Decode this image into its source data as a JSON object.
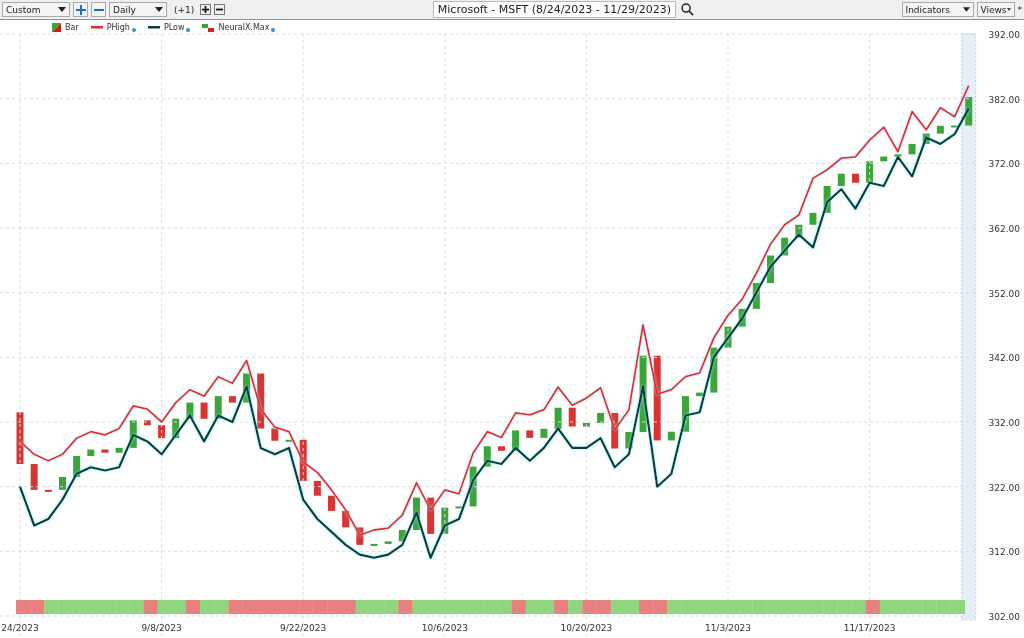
{
  "toolbar": {
    "layout_select": "Custom",
    "interval_select": "Daily",
    "offset": "(+1)",
    "symbol": "Microsoft - MSFT (8/24/2023 - 11/29/2023)",
    "indicators_menu": "Indicators",
    "views_menu": "Views",
    "modified_mark": "*"
  },
  "chart_data": {
    "type": "line",
    "legend": "top-left",
    "grid": true,
    "ylim": [
      302,
      392
    ],
    "categories": [
      "24/2023",
      null,
      null,
      null,
      null,
      null,
      null,
      null,
      null,
      null,
      "9/8/2023",
      null,
      null,
      null,
      null,
      null,
      null,
      null,
      null,
      null,
      "9/22/2023",
      null,
      null,
      null,
      null,
      null,
      null,
      null,
      null,
      null,
      "10/6/2023",
      null,
      null,
      null,
      null,
      null,
      null,
      null,
      null,
      null,
      "10/20/2023",
      null,
      null,
      null,
      null,
      null,
      null,
      null,
      null,
      null,
      "11/3/2023",
      null,
      null,
      null,
      null,
      null,
      null,
      null,
      null,
      null,
      "11/17/2023",
      null,
      null,
      null,
      null,
      null,
      null,
      null
    ],
    "yticks": [
      {
        "value": 392,
        "label": "392.00"
      },
      {
        "value": 382,
        "label": "382.00"
      },
      {
        "value": 372,
        "label": "372.00"
      },
      {
        "value": 362,
        "label": "362.00"
      },
      {
        "value": 352,
        "label": "352.00"
      },
      {
        "value": 342,
        "label": "342.00"
      },
      {
        "value": 332,
        "label": "332.00"
      },
      {
        "value": 322,
        "label": "322.00"
      },
      {
        "value": 312,
        "label": "312.00"
      },
      {
        "value": 302,
        "label": "302.00"
      }
    ],
    "series": [
      {
        "name": "PHigh",
        "color": "#e8282d",
        "values": [
          329,
          327,
          326,
          327,
          329.5,
          330.5,
          330,
          331,
          334.5,
          334,
          332,
          335,
          337,
          336,
          339,
          338,
          341.5,
          334,
          331.2,
          330.5,
          325.8,
          324.2,
          321.5,
          318.4,
          314.5,
          315.3,
          315.6,
          317.6,
          322.6,
          318.4,
          321.5,
          320.9,
          327.2,
          330.5,
          329.6,
          333.4,
          333.1,
          333.9,
          337.4,
          334.6,
          335.7,
          337.3,
          330.8,
          333.9,
          347,
          336.3,
          337,
          339,
          339.6,
          345,
          348.5,
          351,
          355,
          359.5,
          362.5,
          364,
          369.7,
          371,
          372.8,
          373,
          375.6,
          377.6,
          373.8,
          380,
          377.2,
          380.6,
          379.2,
          384
        ]
      },
      {
        "name": "PLow",
        "color": "#0c3b3b",
        "values": [
          322,
          316,
          317,
          320,
          324,
          325,
          324.5,
          325,
          330,
          329,
          327,
          330,
          333,
          329,
          333,
          332,
          337.5,
          328,
          327,
          328,
          320,
          317,
          315,
          313,
          311.5,
          311,
          311.5,
          313,
          318,
          311,
          316,
          317,
          323,
          326,
          325.5,
          328,
          326,
          328,
          331,
          328,
          328,
          329.5,
          325,
          327,
          337.5,
          322,
          324,
          333,
          333.5,
          342,
          345,
          348,
          352,
          356,
          358.5,
          361,
          359,
          366,
          368,
          365,
          369,
          368.5,
          373,
          370,
          376,
          375,
          376.5,
          380.5
        ]
      }
    ]
  },
  "candle_legend": {
    "label": "Bar",
    "info_dot": false
  },
  "legend_marks": [
    {
      "info_dot": true
    },
    {
      "info_dot": true
    }
  ],
  "signal_strip": {
    "name": "NeuralX.Max",
    "info_dot": true,
    "segments": [
      {
        "color": "#e88080"
      },
      {
        "color": "#e88080"
      },
      {
        "color": "#8fd67e"
      },
      {
        "color": "#8fd67e"
      },
      {
        "color": "#8fd67e"
      },
      {
        "color": "#8fd67e"
      },
      {
        "color": "#8fd67e"
      },
      {
        "color": "#8fd67e"
      },
      {
        "color": "#8fd67e"
      },
      {
        "color": "#e88080"
      },
      {
        "color": "#8fd67e"
      },
      {
        "color": "#8fd67e"
      },
      {
        "color": "#e88080"
      },
      {
        "color": "#8fd67e"
      },
      {
        "color": "#8fd67e"
      },
      {
        "color": "#e88080"
      },
      {
        "color": "#e88080"
      },
      {
        "color": "#e88080"
      },
      {
        "color": "#e88080"
      },
      {
        "color": "#e88080"
      },
      {
        "color": "#e88080"
      },
      {
        "color": "#e88080"
      },
      {
        "color": "#e88080"
      },
      {
        "color": "#e88080"
      },
      {
        "color": "#8fd67e"
      },
      {
        "color": "#8fd67e"
      },
      {
        "color": "#8fd67e"
      },
      {
        "color": "#e88080"
      },
      {
        "color": "#8fd67e"
      },
      {
        "color": "#8fd67e"
      },
      {
        "color": "#8fd67e"
      },
      {
        "color": "#8fd67e"
      },
      {
        "color": "#8fd67e"
      },
      {
        "color": "#8fd67e"
      },
      {
        "color": "#8fd67e"
      },
      {
        "color": "#e88080"
      },
      {
        "color": "#8fd67e"
      },
      {
        "color": "#8fd67e"
      },
      {
        "color": "#e88080"
      },
      {
        "color": "#8fd67e"
      },
      {
        "color": "#e88080"
      },
      {
        "color": "#e88080"
      },
      {
        "color": "#8fd67e"
      },
      {
        "color": "#8fd67e"
      },
      {
        "color": "#e88080"
      },
      {
        "color": "#e88080"
      },
      {
        "color": "#8fd67e"
      },
      {
        "color": "#8fd67e"
      },
      {
        "color": "#8fd67e"
      },
      {
        "color": "#8fd67e"
      },
      {
        "color": "#8fd67e"
      },
      {
        "color": "#8fd67e"
      },
      {
        "color": "#8fd67e"
      },
      {
        "color": "#8fd67e"
      },
      {
        "color": "#8fd67e"
      },
      {
        "color": "#8fd67e"
      },
      {
        "color": "#8fd67e"
      },
      {
        "color": "#8fd67e"
      },
      {
        "color": "#8fd67e"
      },
      {
        "color": "#8fd67e"
      },
      {
        "color": "#e88080"
      },
      {
        "color": "#8fd67e"
      },
      {
        "color": "#8fd67e"
      },
      {
        "color": "#8fd67e"
      },
      {
        "color": "#8fd67e"
      },
      {
        "color": "#8fd67e"
      },
      {
        "color": "#8fd67e"
      }
    ]
  }
}
